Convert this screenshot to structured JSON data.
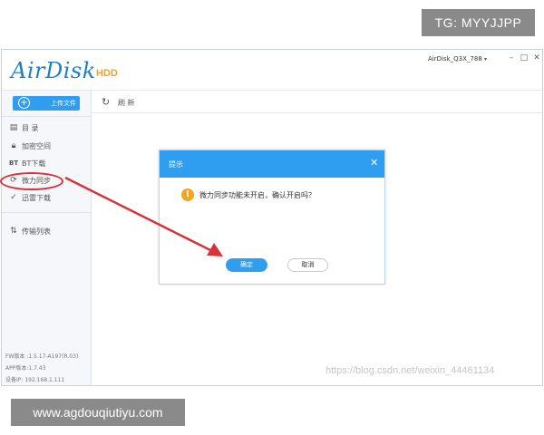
{
  "watermark_badge": "TG: MYYJJPP",
  "url_badge": "www.agdouqiutiyu.com",
  "app": {
    "logo": "AirDisk",
    "logo_suffix": "HDD",
    "device_name": "AirDisk_Q3X_788",
    "device_caret": "▾"
  },
  "sidebar": {
    "upload_label": "上传文件",
    "items": [
      {
        "label": "目 录",
        "icon": "folder-icon"
      },
      {
        "label": "加密空间",
        "icon": "lock-icon"
      },
      {
        "label": "BT下载",
        "icon": "bt-icon"
      },
      {
        "label": "微力同步",
        "icon": "sync-icon"
      },
      {
        "label": "迅雷下载",
        "icon": "thunder-icon"
      },
      {
        "label": "传输列表",
        "icon": "transfer-icon"
      }
    ],
    "footer": {
      "fw": "FW版本 :1.5.17-A197(R.03)",
      "app": "APP版本:1.7.43",
      "address": "设备IP: 192.168.1.111"
    }
  },
  "toolbar": {
    "refresh_label": "刷 新"
  },
  "content_watermark": "https://blog.csdn.net/weixin_44461134",
  "dialog": {
    "title": "提示",
    "message": "微力同步功能未开启，确认开启吗？",
    "confirm_label": "确定",
    "cancel_label": "取消"
  },
  "colors": {
    "accent": "#2f9ef0",
    "annotation": "#d9333a",
    "warning": "#f2a51e",
    "logo": "#1f7fc4"
  }
}
